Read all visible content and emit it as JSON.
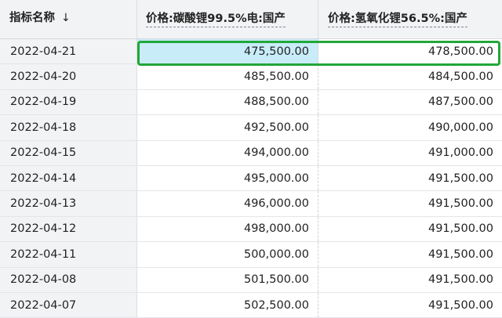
{
  "header": {
    "name_label": "指标名称",
    "sort_icon": "↓",
    "col1_label": "价格:碳酸锂99.5%电:国产",
    "col2_label": "价格:氢氧化锂56.5%:国产"
  },
  "rows": [
    {
      "date": "2022-04-21",
      "v1": "475,500.00",
      "v2": "478,500.00"
    },
    {
      "date": "2022-04-20",
      "v1": "485,500.00",
      "v2": "484,500.00"
    },
    {
      "date": "2022-04-19",
      "v1": "488,500.00",
      "v2": "487,500.00"
    },
    {
      "date": "2022-04-18",
      "v1": "492,500.00",
      "v2": "490,000.00"
    },
    {
      "date": "2022-04-15",
      "v1": "494,000.00",
      "v2": "491,000.00"
    },
    {
      "date": "2022-04-14",
      "v1": "495,000.00",
      "v2": "491,500.00"
    },
    {
      "date": "2022-04-13",
      "v1": "496,000.00",
      "v2": "491,500.00"
    },
    {
      "date": "2022-04-12",
      "v1": "498,000.00",
      "v2": "491,500.00"
    },
    {
      "date": "2022-04-11",
      "v1": "500,000.00",
      "v2": "491,500.00"
    },
    {
      "date": "2022-04-08",
      "v1": "501,500.00",
      "v2": "491,500.00"
    },
    {
      "date": "2022-04-07",
      "v1": "502,500.00",
      "v2": "491,500.00"
    }
  ],
  "colors": {
    "selection_border": "#22a639",
    "selected_cell_bg": "#c9ecf9",
    "header_bg": "#f2f3f5"
  }
}
